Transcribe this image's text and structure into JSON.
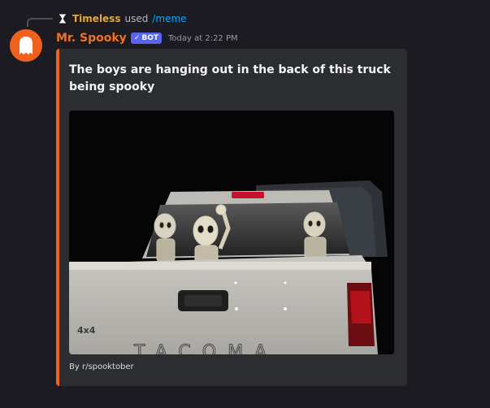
{
  "reply": {
    "user": "Timeless",
    "used": "used",
    "command": "/meme",
    "avatar_icon": "hourglass-icon"
  },
  "message": {
    "author": "Mr. Spooky",
    "author_color": "#f0721f",
    "bot_badge": "BOT",
    "bot_badge_check": "✓",
    "timestamp": "Today at 2:22 PM",
    "avatar_icon": "ghost-icon",
    "avatar_color": "#f0621c"
  },
  "embed": {
    "accent_color": "#f0621c",
    "title": "The boys are hanging out in the back of this truck being spooky",
    "image_texts": {
      "badge_4x4": "4x4",
      "tailgate_brand": "TACOMA"
    },
    "footer": "By r/spooktober"
  }
}
